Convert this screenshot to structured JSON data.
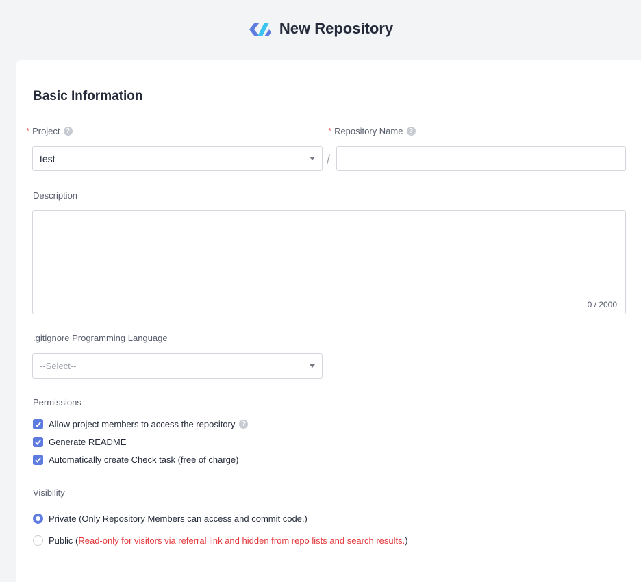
{
  "header": {
    "title": "New Repository",
    "logo_icon": "devcloud-logo-icon"
  },
  "form": {
    "section_title": "Basic Information",
    "project": {
      "label": "Project",
      "value": "test",
      "required_mark": "*",
      "help": "?"
    },
    "separator": "/",
    "repository_name": {
      "label": "Repository Name",
      "value": "",
      "placeholder": "",
      "required_mark": "*",
      "help": "?"
    },
    "description": {
      "label": "Description",
      "value": "",
      "counter": "0 / 2000"
    },
    "gitignore": {
      "label": ".gitignore Programming Language",
      "placeholder": "--Select--"
    },
    "permissions": {
      "label": "Permissions",
      "items": [
        {
          "label": "Allow project members to access the repository",
          "checked": true,
          "help": "?"
        },
        {
          "label": "Generate README",
          "checked": true
        },
        {
          "label": "Automatically create Check task (free of charge)",
          "checked": true
        }
      ]
    },
    "visibility": {
      "label": "Visibility",
      "private": {
        "label": "Private (Only Repository Members can access and commit code.)",
        "selected": true
      },
      "public": {
        "prefix": "Public (",
        "note": "Read-only for visitors via referral link and hidden from repo lists and search results.",
        "suffix": ")",
        "selected": false
      }
    }
  },
  "colors": {
    "accent": "#5e7ce0",
    "required": "#f66f6a",
    "warning_text": "#e3373b"
  }
}
